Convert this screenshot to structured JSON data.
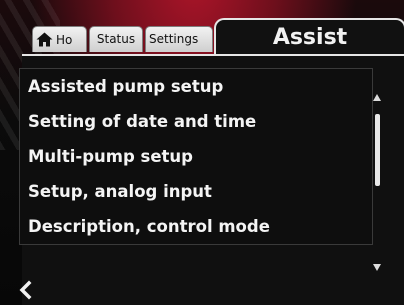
{
  "tabs": [
    {
      "label": "Ho",
      "icon": "home-icon"
    },
    {
      "label": "Status"
    },
    {
      "label": "Settings"
    }
  ],
  "active_tab": {
    "label": "Assist"
  },
  "menu_items": [
    "Assisted pump setup",
    "Setting of date and time",
    "Multi-pump setup",
    "Setup, analog input",
    "Description, control mode"
  ],
  "navigation": {
    "back_icon": "chevron-left-icon"
  },
  "colors": {
    "background": "#101010",
    "text": "#f4f4f4",
    "tab_inactive": "#d9d9d9",
    "device_accent": "#a3142a"
  }
}
